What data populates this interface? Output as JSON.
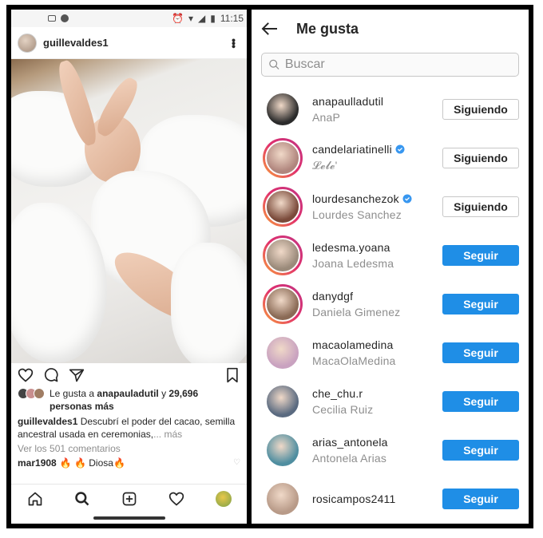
{
  "status_bar": {
    "time": "11:15"
  },
  "post": {
    "username": "guillevaldes1",
    "likes_prefix": "Le gusta a",
    "likes_user": "anapauladutil",
    "likes_middle": "y",
    "likes_count": "29,696",
    "likes_suffix": "personas más",
    "caption_user": "guillevaldes1",
    "caption_text": "Descubrí el poder del cacao, semilla ancestral usada en ceremonias,",
    "caption_more": "... más",
    "view_comments": "Ver los 501 comentarios",
    "comment_user": "mar1908",
    "comment_text": "🔥 🔥 Diosa🔥"
  },
  "likes_screen": {
    "title": "Me gusta",
    "search_placeholder": "Buscar",
    "users": [
      {
        "username": "anapaulladutil",
        "fullname": "AnaP",
        "verified": false,
        "button": "Siguiendo",
        "button_type": "following",
        "ring": "plain",
        "avatar_color": "#2b2b2b"
      },
      {
        "username": "candelariatinelli",
        "fullname": "𝓛𝓮𝓵𝓮'",
        "verified": true,
        "button": "Siguiendo",
        "button_type": "following",
        "ring": "story",
        "avatar_color": "#b0857d"
      },
      {
        "username": "lourdesanchezok",
        "fullname": "Lourdes Sanchez",
        "verified": true,
        "button": "Siguiendo",
        "button_type": "following",
        "ring": "story",
        "avatar_color": "#7a4a3a"
      },
      {
        "username": "ledesma.yoana",
        "fullname": "Joana Ledesma",
        "verified": false,
        "button": "Seguir",
        "button_type": "follow",
        "ring": "story",
        "avatar_color": "#9a8a7a"
      },
      {
        "username": "danydgf",
        "fullname": "Daniela Gimenez",
        "verified": false,
        "button": "Seguir",
        "button_type": "follow",
        "ring": "story",
        "avatar_color": "#8a6a55"
      },
      {
        "username": "macaolamedina",
        "fullname": "MacaOlaMedina",
        "verified": false,
        "button": "Seguir",
        "button_type": "follow",
        "ring": "plain",
        "avatar_color": "#c9a2c0"
      },
      {
        "username": "che_chu.r",
        "fullname": "Cecilia Ruiz",
        "verified": false,
        "button": "Seguir",
        "button_type": "follow",
        "ring": "plain",
        "avatar_color": "#5a6a80"
      },
      {
        "username": "arias_antonela",
        "fullname": "Antonela Arias",
        "verified": false,
        "button": "Seguir",
        "button_type": "follow",
        "ring": "plain",
        "avatar_color": "#4f8ea0"
      },
      {
        "username": "rosicampos2411",
        "fullname": "",
        "verified": false,
        "button": "Seguir",
        "button_type": "follow",
        "ring": "plain",
        "avatar_color": "#b89a88"
      }
    ]
  }
}
